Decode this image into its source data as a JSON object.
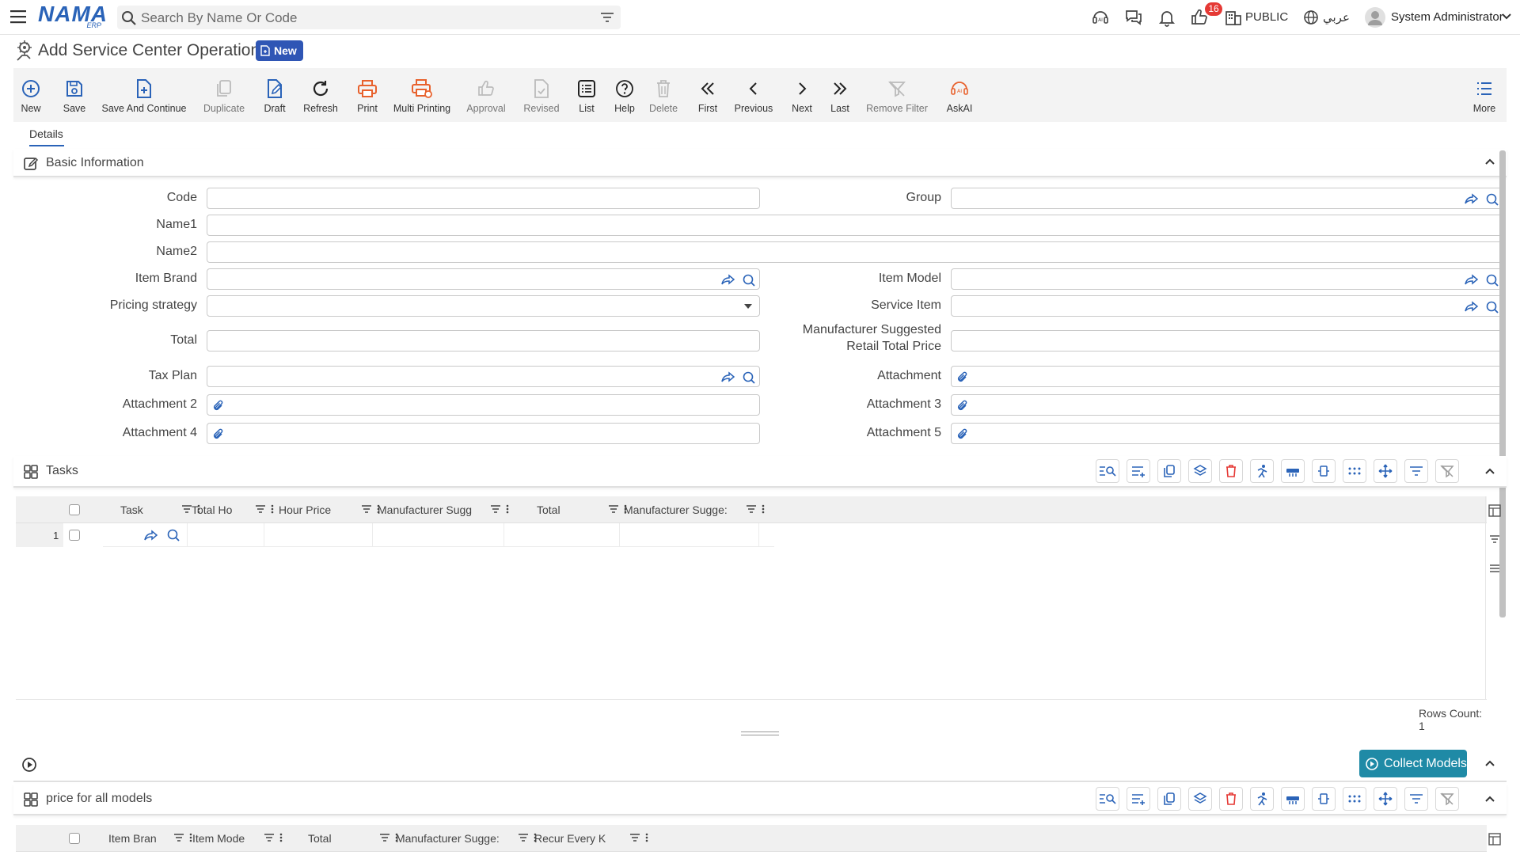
{
  "topbar": {
    "search_placeholder": "Search By Name Or Code",
    "notification_count": "16",
    "workspace_label": "PUBLIC",
    "language_label": "عربي",
    "user_name": "System Administrator"
  },
  "page": {
    "title": "Add Service Center Operation",
    "status_badge": "New"
  },
  "toolbar": {
    "new": "New",
    "save": "Save",
    "save_continue": "Save And Continue",
    "duplicate": "Duplicate",
    "draft": "Draft",
    "refresh": "Refresh",
    "print": "Print",
    "multi_printing": "Multi Printing",
    "approval": "Approval",
    "revised": "Revised",
    "list": "List",
    "help": "Help",
    "delete": "Delete",
    "first": "First",
    "previous": "Previous",
    "next": "Next",
    "last": "Last",
    "remove_filter": "Remove Filter",
    "askai": "AskAI",
    "more": "More"
  },
  "tabs": {
    "details": "Details"
  },
  "basic_info": {
    "title": "Basic Information",
    "labels": {
      "code": "Code",
      "group": "Group",
      "name1": "Name1",
      "name2": "Name2",
      "item_brand": "Item Brand",
      "item_model": "Item Model",
      "pricing_strategy": "Pricing strategy",
      "service_item": "Service Item",
      "total": "Total",
      "msrp_line1": "Manufacturer Suggested",
      "msrp_line2": "Retail Total Price",
      "tax_plan": "Tax Plan",
      "attachment": "Attachment",
      "attachment2": "Attachment 2",
      "attachment3": "Attachment 3",
      "attachment4": "Attachment 4",
      "attachment5": "Attachment 5"
    }
  },
  "tasks": {
    "title": "Tasks",
    "columns": [
      "Task",
      "Total Ho",
      "Hour Price",
      "Manufacturer Sugg",
      "Total",
      "Manufacturer Sugge:"
    ],
    "rows": [
      {
        "num": "1"
      }
    ],
    "rows_count": "Rows Count: 1"
  },
  "collect_models": {
    "label": "Collect Models"
  },
  "price_all_models": {
    "title": "price for all models",
    "columns": [
      "Item Bran",
      "Item Mode",
      "Total",
      "Manufacturer Sugge:",
      "Recur Every K"
    ]
  },
  "colors": {
    "brand_blue": "#2a63b8",
    "badge_blue": "#2f56b5",
    "teal": "#1f8aa6",
    "danger": "#e53935",
    "print_orange": "#e8612c"
  }
}
